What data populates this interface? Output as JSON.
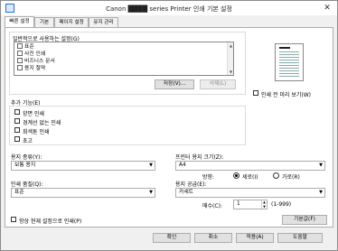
{
  "window": {
    "title": "Canon ████ series Printer 인쇄 기본 설정"
  },
  "tabs": [
    {
      "label": "빠른 설정"
    },
    {
      "label": "기본"
    },
    {
      "label": "페이지 설정"
    },
    {
      "label": "유지 관리"
    }
  ],
  "common_settings": {
    "label": "일반적으로 사용하는 설정(G)",
    "items": [
      "표준",
      "사진 인쇄",
      "비즈니스 문서",
      "용지 절약"
    ],
    "save_button": "저장(V)...",
    "delete_button": "삭제(L)"
  },
  "preview": {
    "checkbox_label": "인쇄 전 미리 보기(W)"
  },
  "additional": {
    "label": "추가 기능(E)",
    "items": [
      "양면 인쇄",
      "경계선 없는 인쇄",
      "회색톤 인쇄",
      "초고"
    ]
  },
  "media_type": {
    "label": "용지 종류(Y):",
    "value": "보통 용지"
  },
  "paper_size": {
    "label": "프린터 용지 크기(Z):",
    "value": "A4"
  },
  "orientation": {
    "label": "방향:",
    "portrait": "세로(I)",
    "landscape": "가로(R)"
  },
  "print_quality": {
    "label": "인쇄 품질(Q):",
    "value": "표준"
  },
  "paper_source": {
    "label": "용지 공급(E):",
    "value": "카세트"
  },
  "copies": {
    "label": "매수(C):",
    "value": "1",
    "range": "(1-999)"
  },
  "always_print": {
    "label": "항상 현재 설정으로 인쇄(P)"
  },
  "defaults_button": "기본값(F)",
  "footer": {
    "ok": "확인",
    "cancel": "취소",
    "apply": "적용(A)",
    "help": "도움말"
  }
}
